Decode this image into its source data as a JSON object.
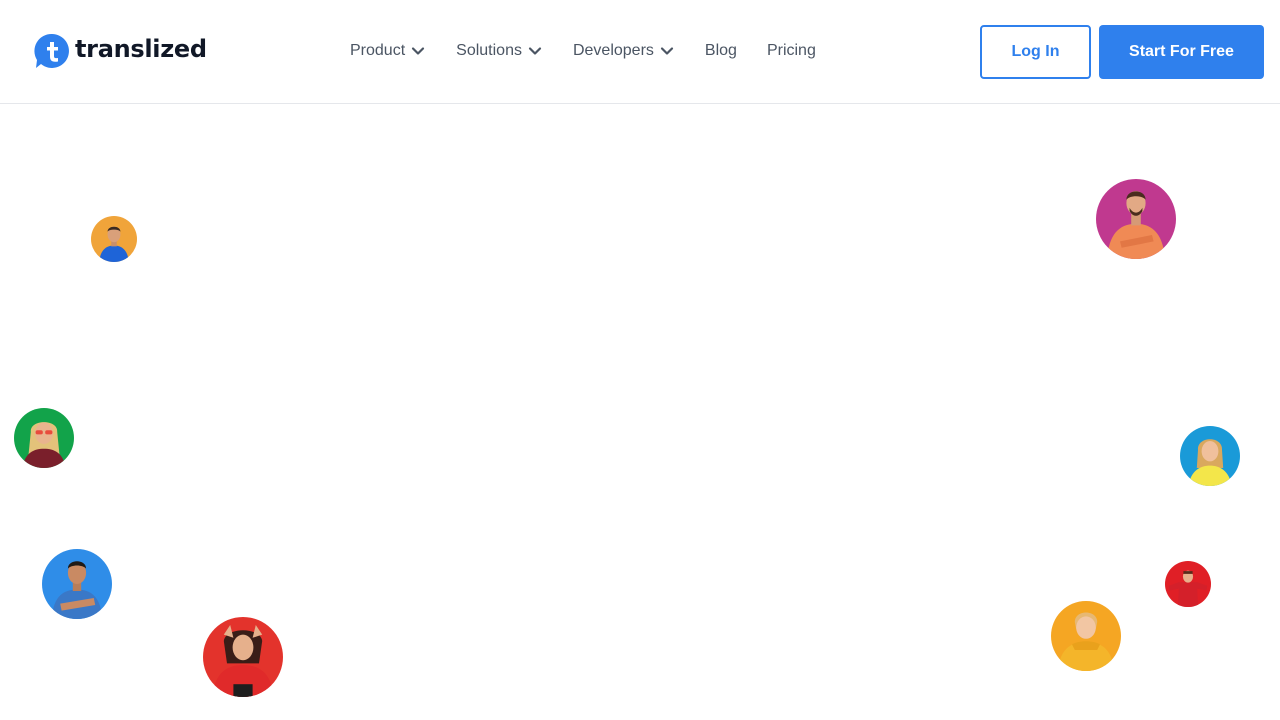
{
  "brand": {
    "name": "translized",
    "logo_letter": "t",
    "color": "#2f80ed"
  },
  "nav": {
    "items": [
      {
        "label": "Product",
        "has_dropdown": true,
        "icon": "chevron-down-icon"
      },
      {
        "label": "Solutions",
        "has_dropdown": true,
        "icon": "chevron-down-icon"
      },
      {
        "label": "Developers",
        "has_dropdown": true,
        "icon": "chevron-down-icon"
      },
      {
        "label": "Blog",
        "has_dropdown": false
      },
      {
        "label": "Pricing",
        "has_dropdown": false
      }
    ]
  },
  "actions": {
    "login_label": "Log In",
    "start_label": "Start For Free"
  },
  "avatars": [
    {
      "name": "avatar-man-blue-shirt-orange-bg",
      "bg": "#f0a43a",
      "shirt": "#1e64d8"
    },
    {
      "name": "avatar-woman-green-bg",
      "bg": "#12a34a",
      "shirt": "#7a1f2b"
    },
    {
      "name": "avatar-man-crossed-arms-blue-bg",
      "bg": "#2f8de8",
      "shirt": "#3a78c7"
    },
    {
      "name": "avatar-woman-red-sweater-red-bg",
      "bg": "#e3332c",
      "shirt": "#e02a2a"
    },
    {
      "name": "avatar-man-orange-sweater-pink-bg",
      "bg": "#c0398f",
      "shirt": "#f08a55"
    },
    {
      "name": "avatar-woman-yellow-blue-bg",
      "bg": "#1a9ad8",
      "shirt": "#f3e64a"
    },
    {
      "name": "avatar-man-red-bg",
      "bg": "#e01f26",
      "shirt": "#d4202a"
    },
    {
      "name": "avatar-woman-yellow-sweater-orange-bg",
      "bg": "#f5a623",
      "shirt": "#f4b52a"
    }
  ]
}
